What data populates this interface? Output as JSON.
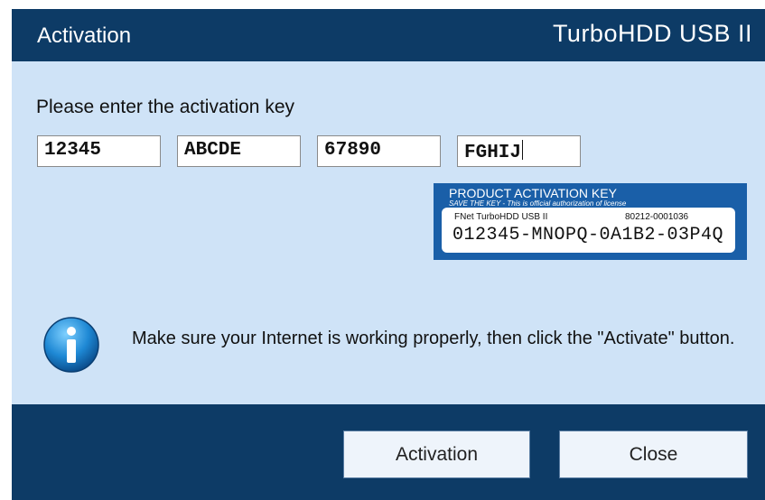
{
  "window": {
    "title": "Activation",
    "brand": "TurboHDD USB II"
  },
  "form": {
    "prompt": "Please enter the activation key",
    "keys": [
      "12345",
      "ABCDE",
      "67890",
      "FGHIJ"
    ]
  },
  "sample_card": {
    "title": "PRODUCT ACTIVATION KEY",
    "subtitle": "SAVE THE KEY - This is official authorization of license",
    "product": "FNet TurboHDD USB II",
    "serial": "80212-0001036",
    "key": "012345-MNOPQ-0A1B2-03P4Q"
  },
  "info": {
    "icon": "info-icon",
    "message": "Make sure your Internet is working properly, then click the \"Activate\" button."
  },
  "buttons": {
    "activation": "Activation",
    "close": "Close"
  },
  "colors": {
    "header": "#0d3b66",
    "body": "#cfe3f7",
    "card": "#1a5fa8"
  }
}
